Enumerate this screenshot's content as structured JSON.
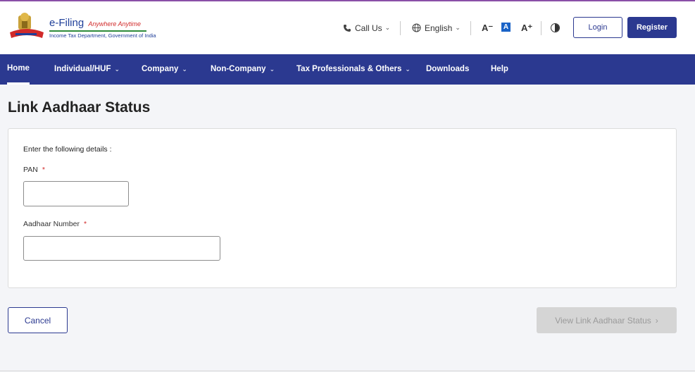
{
  "header": {
    "brand_title": "e-Filing",
    "brand_tagline": "Anywhere Anytime",
    "brand_subtitle": "Income Tax Department, Government of India",
    "call_us": "Call Us",
    "language": "English",
    "font_decrease": "A⁻",
    "font_default": "A",
    "font_increase": "A⁺",
    "login": "Login",
    "register": "Register"
  },
  "nav": {
    "items": [
      {
        "label": "Home"
      },
      {
        "label": "Individual/HUF"
      },
      {
        "label": "Company"
      },
      {
        "label": "Non-Company"
      },
      {
        "label": "Tax Professionals & Others"
      },
      {
        "label": "Downloads"
      },
      {
        "label": "Help"
      }
    ]
  },
  "page": {
    "title": "Link Aadhaar Status",
    "intro": "Enter the following details :",
    "pan_label": "PAN",
    "aadhaar_label": "Aadhaar Number",
    "required_mark": "*",
    "pan_value": "",
    "aadhaar_value": ""
  },
  "actions": {
    "cancel": "Cancel",
    "view_status": "View Link Aadhaar Status"
  },
  "colors": {
    "primary": "#2b3990",
    "required": "#d12a2a",
    "disabled_bg": "#d5d5d5"
  }
}
